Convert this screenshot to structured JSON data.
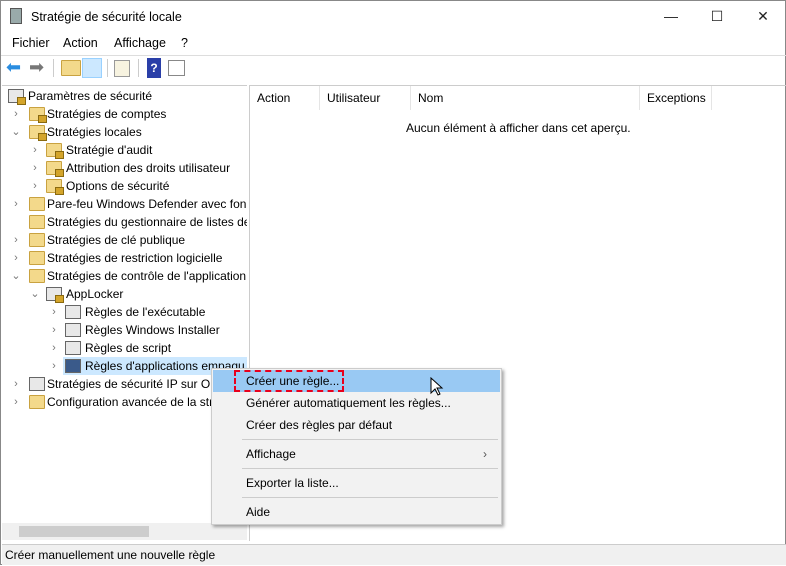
{
  "window": {
    "title": "Stratégie de sécurité locale",
    "minimize": "—",
    "maximize": "☐",
    "close": "✕"
  },
  "menu": [
    "Fichier",
    "Action",
    "Affichage",
    "?"
  ],
  "toolbar": [
    "back-icon",
    "forward-icon",
    "up-folder-icon",
    "show-hide-tree-icon",
    "export-list-icon",
    "help-icon",
    "show-action-pane-icon"
  ],
  "tree": [
    {
      "label": "Paramètres de sécurité",
      "level": 0,
      "expander": "",
      "icon": "security-settings-icon"
    },
    {
      "label": "Stratégies de comptes",
      "level": 1,
      "expander": "›",
      "icon": "folder-lock-icon"
    },
    {
      "label": "Stratégies locales",
      "level": 1,
      "expander": "⌄",
      "icon": "folder-lock-icon"
    },
    {
      "label": "Stratégie d'audit",
      "level": 2,
      "expander": "›",
      "icon": "folder-lock-icon"
    },
    {
      "label": "Attribution des droits utilisateur",
      "level": 2,
      "expander": "›",
      "icon": "folder-lock-icon"
    },
    {
      "label": "Options de sécurité",
      "level": 2,
      "expander": "›",
      "icon": "folder-lock-icon"
    },
    {
      "label": "Pare-feu Windows Defender avec fon",
      "level": 1,
      "expander": "›",
      "icon": "folder-icon"
    },
    {
      "label": "Stratégies du gestionnaire de listes de",
      "level": 1,
      "expander": "",
      "icon": "folder-icon"
    },
    {
      "label": "Stratégies de clé publique",
      "level": 1,
      "expander": "›",
      "icon": "folder-icon"
    },
    {
      "label": "Stratégies de restriction logicielle",
      "level": 1,
      "expander": "›",
      "icon": "folder-icon"
    },
    {
      "label": "Stratégies de contrôle de l'application",
      "level": 1,
      "expander": "⌄",
      "icon": "folder-icon"
    },
    {
      "label": "AppLocker",
      "level": 2,
      "expander": "⌄",
      "icon": "applocker-icon"
    },
    {
      "label": "Règles de l'exécutable",
      "level": 3,
      "expander": "›",
      "icon": "executable-icon"
    },
    {
      "label": "Règles Windows Installer",
      "level": 3,
      "expander": "›",
      "icon": "installer-icon"
    },
    {
      "label": "Règles de script",
      "level": 3,
      "expander": "›",
      "icon": "script-icon"
    },
    {
      "label": "Règles d'applications empaqu",
      "level": 3,
      "expander": "›",
      "icon": "packaged-app-icon",
      "selected": true
    },
    {
      "label": "Stratégies de sécurité IP sur Ord",
      "level": 1,
      "expander": "›",
      "icon": "ip-security-icon"
    },
    {
      "label": "Configuration avancée de la str",
      "level": 1,
      "expander": "›",
      "icon": "folder-icon"
    }
  ],
  "list": {
    "columns": [
      "Action",
      "Utilisateur",
      "Nom",
      "Exceptions"
    ],
    "empty": "Aucun élément à afficher dans cet aperçu."
  },
  "context_menu": {
    "items": [
      "Créer une règle...",
      "Générer automatiquement les règles...",
      "Créer des règles par défaut",
      "Affichage",
      "Exporter la liste...",
      "Aide"
    ],
    "submenu_arrow": "›"
  },
  "status": "Créer manuellement une nouvelle règle",
  "colors": {
    "highlight": "#99c9f3",
    "annotation": "#e8001c",
    "selection": "#cce8ff"
  }
}
